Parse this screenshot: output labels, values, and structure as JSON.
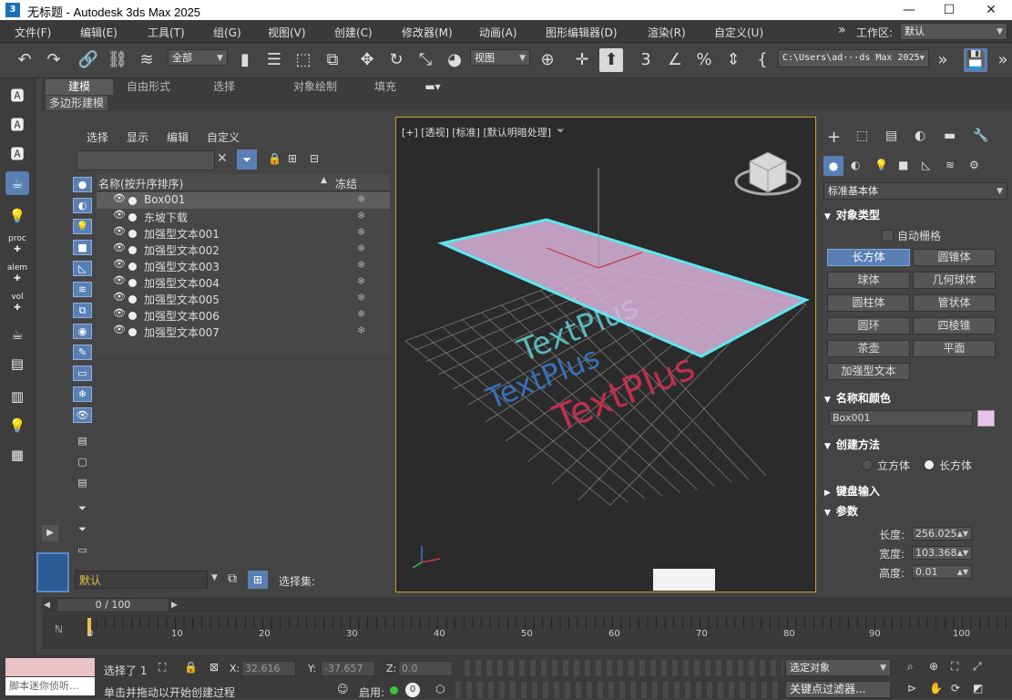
{
  "titlebar": {
    "app_badge": "3",
    "title": "无标题 - Autodesk 3ds Max 2025",
    "minimize": "—",
    "maximize": "☐",
    "close": "✕"
  },
  "menubar": {
    "items": [
      "文件(F)",
      "编辑(E)",
      "工具(T)",
      "组(G)",
      "视图(V)",
      "创建(C)",
      "修改器(M)",
      "动画(A)",
      "图形编辑器(D)",
      "渲染(R)",
      "自定义(U)"
    ],
    "more": "»",
    "workspace_label": "工作区:",
    "workspace_value": "默认"
  },
  "toolbar": {
    "selection_filter": "全部",
    "ref_coord": "视图",
    "project_path": "C:\\Users\\ad···ds Max 2025"
  },
  "ribbon": {
    "tabs": [
      "建模",
      "自由形式",
      "选择",
      "对象绘制",
      "填充"
    ],
    "subtab": "多边形建模"
  },
  "left_strip": {
    "labels": [
      "proc",
      "alem",
      "vol"
    ]
  },
  "explorer": {
    "menu": [
      "选择",
      "显示",
      "编辑",
      "自定义"
    ],
    "col_name": "名称(按升序排序)",
    "sort_arrow": "▲",
    "col_frozen": "冻结",
    "rows": [
      "Box001",
      "东坡下载",
      "加强型文本001",
      "加强型文本002",
      "加强型文本003",
      "加强型文本004",
      "加强型文本005",
      "加强型文本006",
      "加强型文本007"
    ],
    "freeze_glyph": "❄",
    "layer": "默认",
    "selection_set_label": "选择集:"
  },
  "viewport": {
    "label": "[+] [透视] [标准] [默认明暗处理]",
    "texts": [
      "TextPlus",
      "TextPlus",
      "TextPlus"
    ],
    "colors": {
      "box": "#d9b3da",
      "box_edge": "#5ee7f0",
      "text_red": "#c4314f",
      "text_blue": "#3b77c9",
      "text_cyan": "#5ec6c7"
    }
  },
  "command_panel": {
    "category": "标准基本体",
    "object_type": "对象类型",
    "autogrid": "自动栅格",
    "buttons": [
      "长方体",
      "圆锥体",
      "球体",
      "几何球体",
      "圆柱体",
      "管状体",
      "圆环",
      "四棱锥",
      "茶壶",
      "平面",
      "加强型文本"
    ],
    "name_color": "名称和颜色",
    "object_name": "Box001",
    "object_color": "#e8c2ec",
    "creation_method": "创建方法",
    "method_cube": "立方体",
    "method_box": "长方体",
    "keyboard_entry": "键盘输入",
    "parameters": "参数",
    "length_label": "长度:",
    "length_value": "256.025",
    "width_label": "宽度:",
    "width_value": "103.368",
    "height_label": "高度:",
    "height_value": "0.01"
  },
  "timeline": {
    "frame": "0 / 100",
    "ticks": [
      "0",
      "10",
      "20",
      "30",
      "40",
      "50",
      "60",
      "70",
      "80",
      "90",
      "100"
    ]
  },
  "statusbar": {
    "maxscript_hint": "脚本迷你侦听...",
    "selected": "选择了 1",
    "x_label": "X:",
    "x_value": "32.616",
    "y_label": "Y:",
    "y_value": "-37.657",
    "z_label": "Z:",
    "z_value": "0.0",
    "prompt": "单击并拖动以开始创建过程",
    "enable": "启用:",
    "selected_objects": "选定对象",
    "keyfilter": "关键点过滤器..."
  }
}
